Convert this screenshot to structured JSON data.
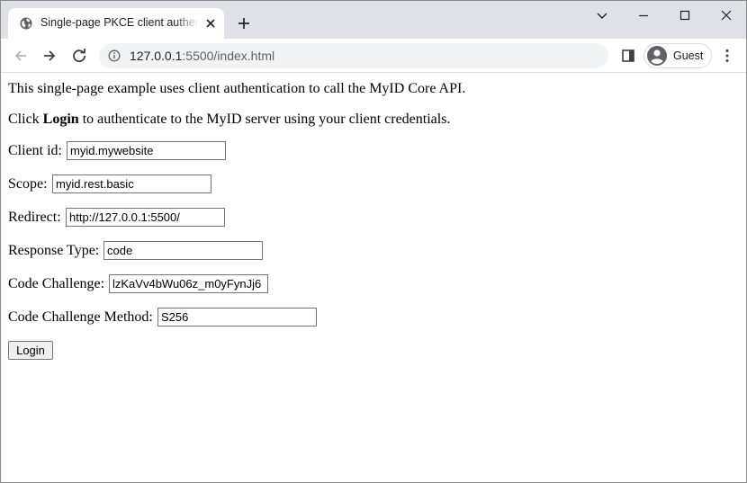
{
  "browser": {
    "tab_title": "Single-page PKCE client authentication",
    "url_host": "127.0.0.1",
    "url_path": ":5500/index.html",
    "profile_name": "Guest"
  },
  "icons": {
    "favicon": "globe-icon",
    "tab_close": "close-icon",
    "new_tab": "plus-icon",
    "back": "arrow-left-icon",
    "forward": "arrow-right-icon",
    "reload": "reload-icon",
    "site_info": "info-icon",
    "side_panel": "side-panel-icon",
    "avatar": "person-icon",
    "menu": "kebab-menu-icon"
  },
  "page": {
    "intro": "This single-page example uses client authentication to call the MyID Core API.",
    "instr_prefix": "Click ",
    "instr_bold": "Login",
    "instr_suffix": " to authenticate to the MyID server using your client credentials.",
    "fields": [
      {
        "label": "Client id:",
        "value": "myid.mywebsite"
      },
      {
        "label": "Scope:",
        "value": "myid.rest.basic"
      },
      {
        "label": "Redirect:",
        "value": "http://127.0.0.1:5500/"
      },
      {
        "label": "Response Type:",
        "value": "code"
      },
      {
        "label": "Code Challenge:",
        "value": "lzKaVv4bWu06z_m0yFynJj6"
      },
      {
        "label": "Code Challenge Method:",
        "value": "S256"
      }
    ],
    "login_label": "Login"
  }
}
